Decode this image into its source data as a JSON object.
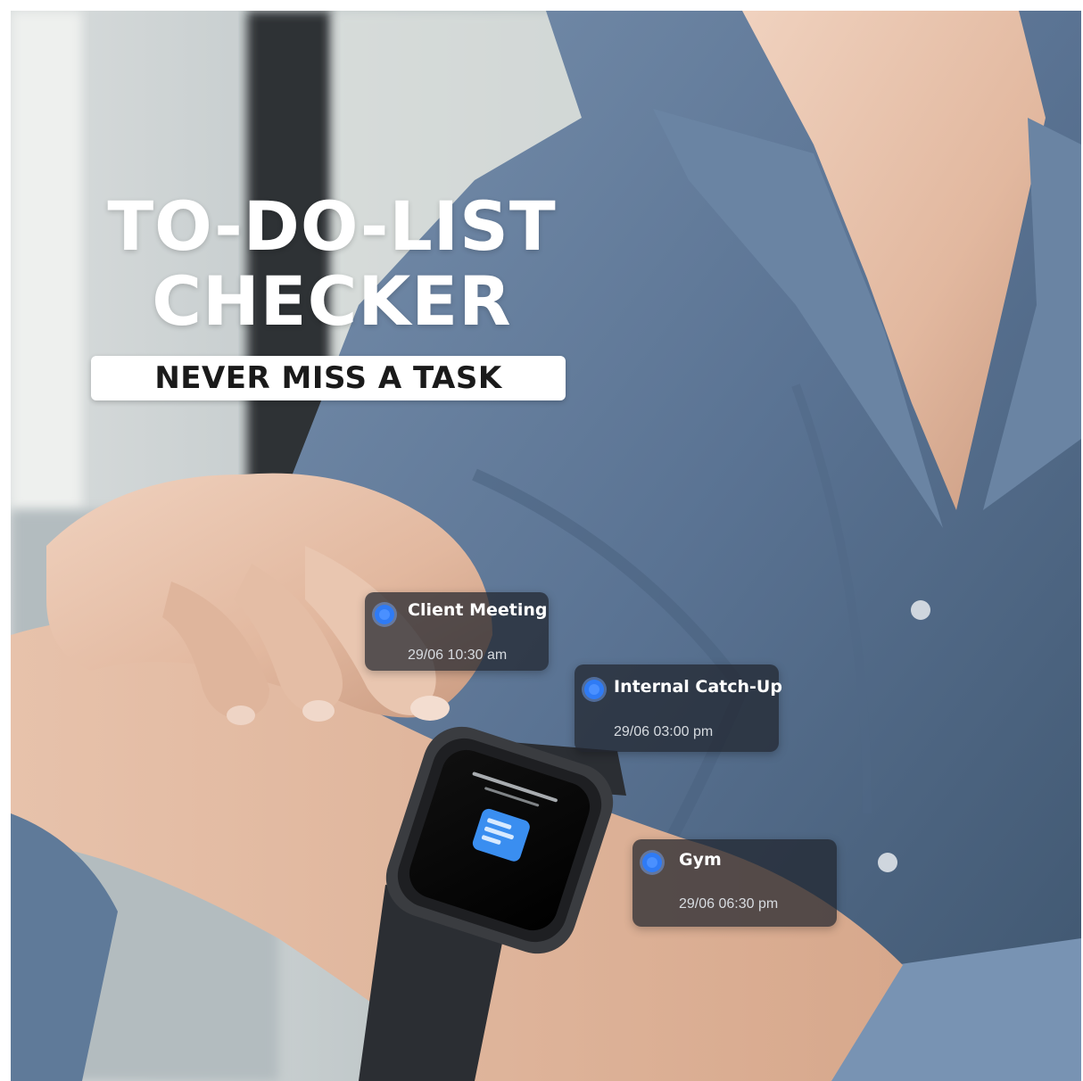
{
  "headline": {
    "line1": "TO-DO-LIST",
    "line2": "CHECKER"
  },
  "tagline": "NEVER MISS A TASK",
  "tasks": [
    {
      "title": "Client Meeting",
      "time": "29/06 10:30 am"
    },
    {
      "title": "Internal Catch-Up",
      "time": "29/06 03:00 pm"
    },
    {
      "title": "Gym",
      "time": "29/06 06:30 pm"
    }
  ],
  "colors": {
    "task_dot": "#2f7bf5",
    "shirt": "#5a7393",
    "card_bg": "#20242c"
  },
  "icons": [
    "task-dot-icon",
    "smartwatch-app-icon"
  ]
}
